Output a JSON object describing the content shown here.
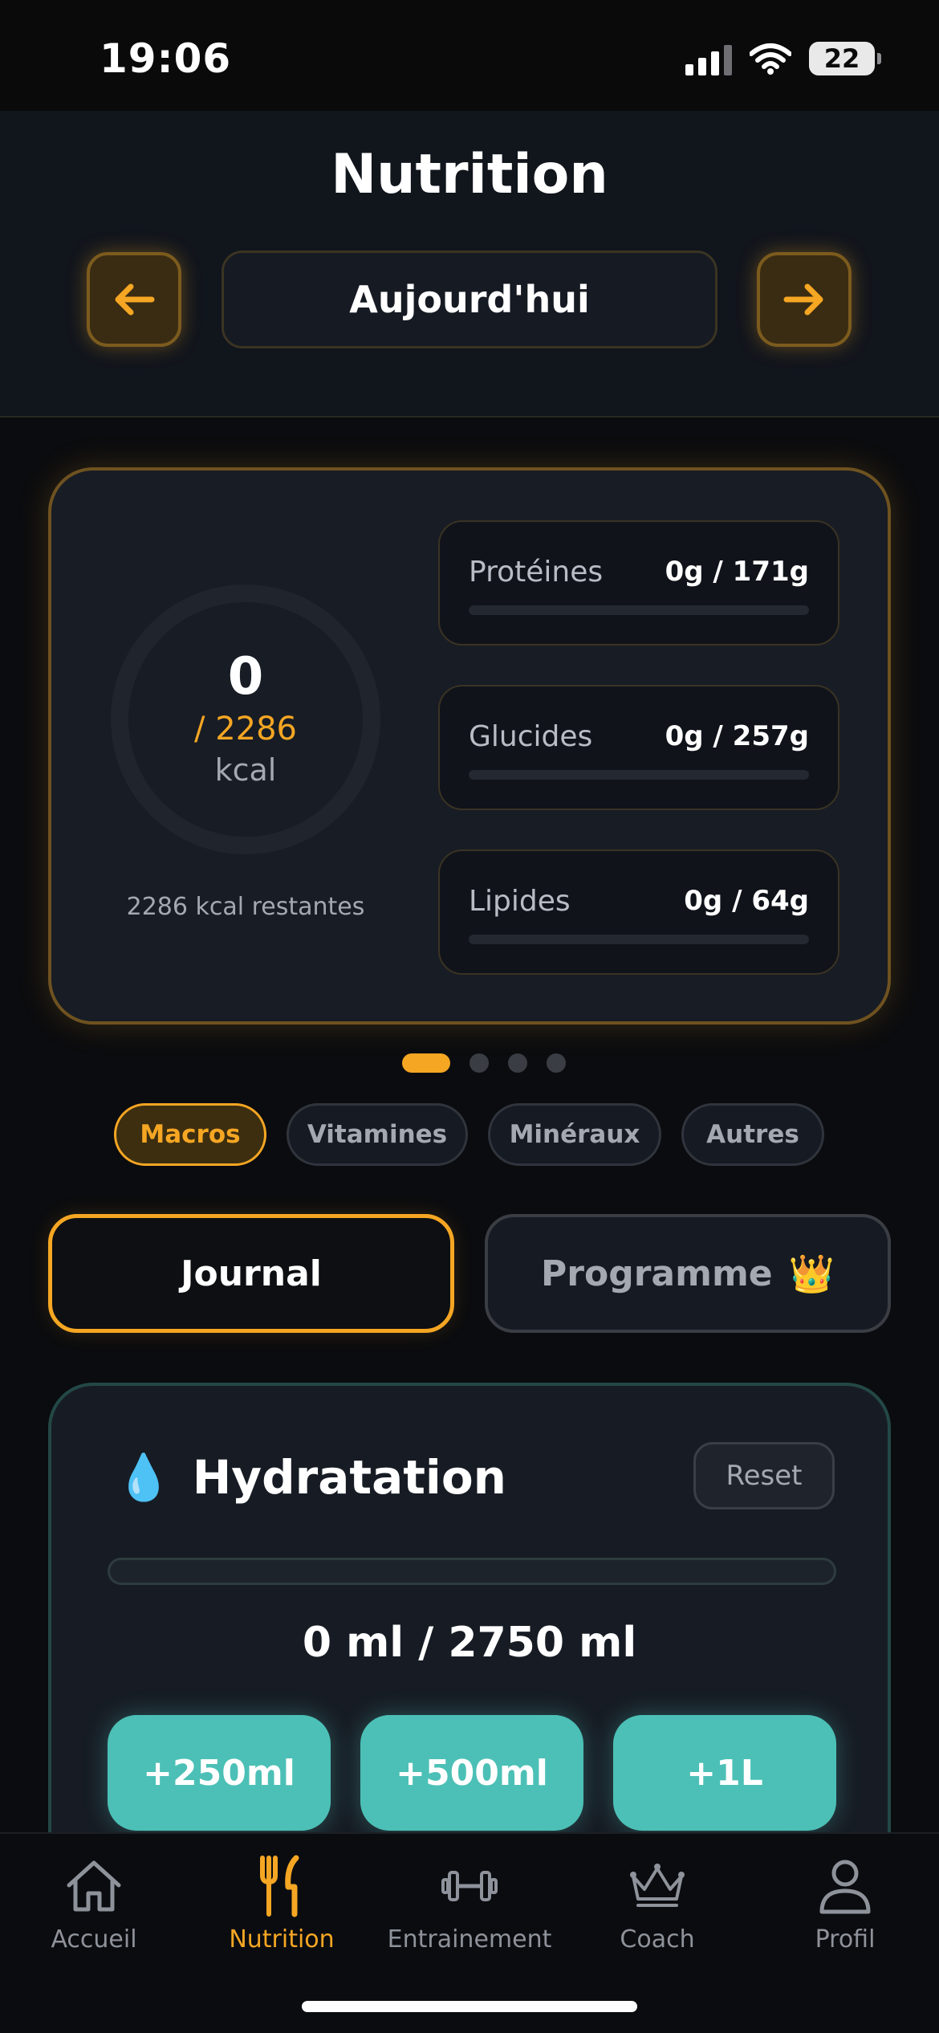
{
  "status_bar": {
    "time": "19:06",
    "battery": "22"
  },
  "header": {
    "title": "Nutrition",
    "date_label": "Aujourd'hui"
  },
  "summary": {
    "kcal_consumed": "0",
    "kcal_goal": "/ 2286",
    "kcal_unit": "kcal",
    "remaining": "2286 kcal restantes",
    "macros": [
      {
        "label": "Protéines",
        "value": "0g / 171g",
        "progress": 0
      },
      {
        "label": "Glucides",
        "value": "0g / 257g",
        "progress": 0
      },
      {
        "label": "Lipides",
        "value": "0g / 64g",
        "progress": 0
      }
    ]
  },
  "pager": {
    "pages": 4,
    "active": 0
  },
  "chips": [
    {
      "label": "Macros",
      "active": true
    },
    {
      "label": "Vitamines",
      "active": false
    },
    {
      "label": "Minéraux",
      "active": false
    },
    {
      "label": "Autres",
      "active": false
    }
  ],
  "toggle": {
    "journal": "Journal",
    "programme": "Programme",
    "programme_icon": "👑"
  },
  "hydration": {
    "icon": "💧",
    "title": "Hydratation",
    "reset_label": "Reset",
    "amount": "0 ml / 2750 ml",
    "progress": 0,
    "buttons": [
      "+250ml",
      "+500ml",
      "+1L"
    ]
  },
  "tab_bar": [
    {
      "label": "Accueil",
      "icon": "home-icon",
      "active": false
    },
    {
      "label": "Nutrition",
      "icon": "fork-knife-icon",
      "active": true
    },
    {
      "label": "Entrainement",
      "icon": "dumbbell-icon",
      "active": false
    },
    {
      "label": "Coach",
      "icon": "crown-icon",
      "active": false
    },
    {
      "label": "Profil",
      "icon": "person-icon",
      "active": false
    }
  ],
  "colors": {
    "accent": "#f5a623",
    "teal": "#4cc0b6",
    "background": "#0b0c0f"
  }
}
